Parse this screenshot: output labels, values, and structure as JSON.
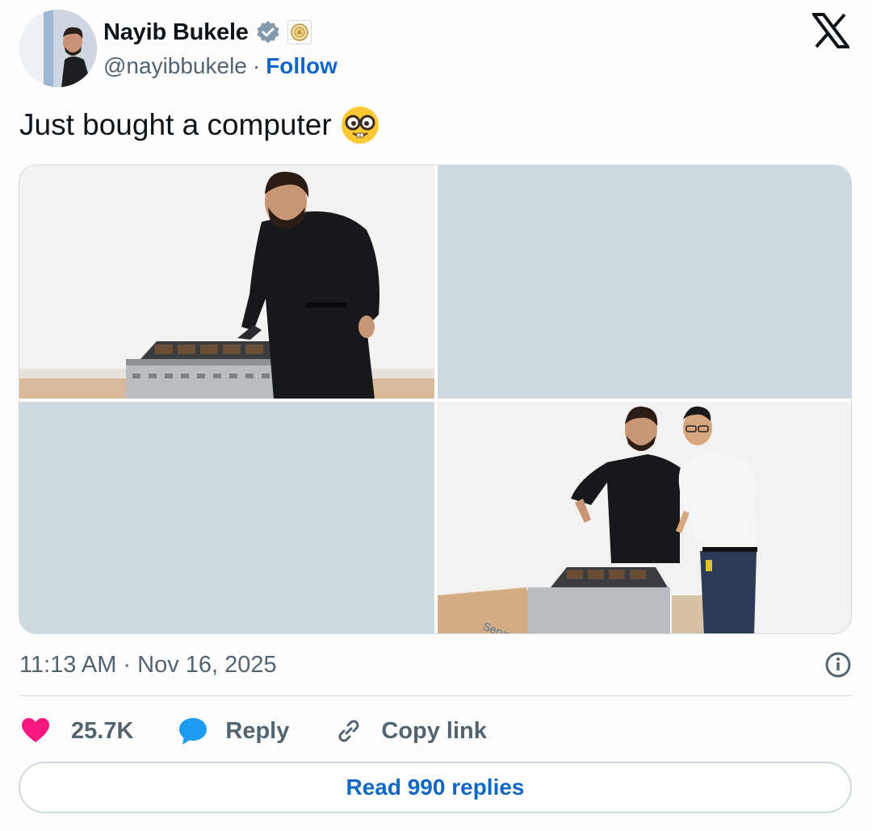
{
  "author": {
    "name": "Nayib Bukele",
    "handle": "@nayibbukele",
    "separator": "·",
    "follow_label": "Follow",
    "verified_icon": "verified-badge-icon",
    "affiliation_icon": "government-seal-icon"
  },
  "tweet": {
    "text": "Just bought a computer",
    "emoji": "nerd-face-emoji"
  },
  "media": {
    "photos": [
      {
        "slot": "top-left",
        "loaded": true
      },
      {
        "slot": "top-right",
        "loaded": false
      },
      {
        "slot": "bottom-left",
        "loaded": false
      },
      {
        "slot": "bottom-right",
        "loaded": true
      }
    ]
  },
  "meta": {
    "timestamp": "11:13 AM · Nov 16, 2025"
  },
  "actions": {
    "likes_count": "25.7K",
    "reply_label": "Reply",
    "copy_link_label": "Copy link"
  },
  "footer": {
    "read_replies_label": "Read 990 replies"
  },
  "colors": {
    "accent": "#1167c4",
    "heart": "#f91880",
    "reply_bubble": "#1d9bf0",
    "placeholder": "#cfd9e0",
    "muted_text": "#536471"
  }
}
